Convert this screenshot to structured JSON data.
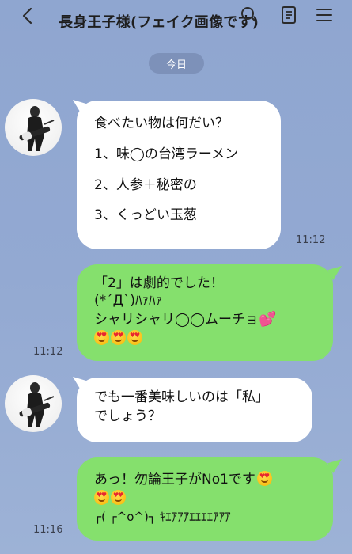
{
  "header": {
    "title": "長身王子様(フェイク画像です)"
  },
  "date_label": "今日",
  "messages": [
    {
      "side": "left",
      "lines": [
        "食べたい物は何だい？",
        "1、味◯の台湾ラーメン",
        "2、人参＋秘密の",
        "3、くっどい玉葱"
      ],
      "time": "11:12"
    },
    {
      "side": "right",
      "lines": [
        "「2」は劇的でした！",
        "(*´Д`)ﾊｧﾊｧ",
        "シャリシャリ◯◯ムーチョ"
      ],
      "time": "11:12"
    },
    {
      "side": "left",
      "lines": [
        "でも一番美味しいのは「私」",
        "でしょう？"
      ]
    },
    {
      "side": "right",
      "lines": [
        "あっ！勿論王子がNo1です",
        "┌( ┌^o^)┐ ｷｴｱｱｱｴｴｴｴｱｱｱ"
      ],
      "time": "11:16"
    }
  ],
  "icons": {
    "back": "chevron-left-icon",
    "search": "search-icon",
    "memo": "notes-icon",
    "menu": "hamburger-menu-icon",
    "emoji": "heart-eyes-emoji",
    "heart": "sparkling-heart-emoji"
  },
  "colors": {
    "background": "#93a9d2",
    "sent_bubble": "#85e06d",
    "received_bubble": "#ffffff"
  }
}
